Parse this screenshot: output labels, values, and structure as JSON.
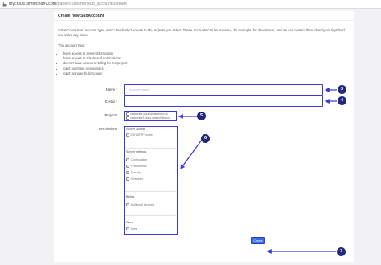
{
  "browser": {
    "url_host": "mycloud.simtechdev.com",
    "url_path": "/panel/customer/sub_accounts/create"
  },
  "form": {
    "title": "Create new SubAccount",
    "description": "SubAccount is an account type, which has limited access to the projects you select. These accounts can be provided, for example, for developers, and we can contact them directly via MyCloud and solve any issue.",
    "type_label": "This account type:",
    "type_bullets": [
      "have access to server information",
      "have access to tickets and notifications",
      "doesn't have access to billing for the project",
      "can't purchase new servers",
      "can't manage SubAccount"
    ],
    "name_label": "Name *",
    "name_placeholder": "Account name",
    "email_label": "E-Mail *",
    "projects_label": "Projects",
    "projects": [
      "testcentre.cloud.simtechdev.co",
      "testcentre2.cloud.simtechdev.co"
    ],
    "permissions_label": "Permissions",
    "permissions": {
      "server_access": {
        "title": "Server access",
        "items": [
          "SSH/SFTP Users"
        ]
      },
      "server_settings": {
        "title": "Server settings",
        "items": [
          "Configuration",
          "Performance",
          "Security",
          "Scheduler"
        ]
      },
      "billing": {
        "title": "Billing",
        "items": [
          "Additional services"
        ]
      },
      "sites": {
        "title": "Sites",
        "items": [
          "Sites"
        ]
      }
    },
    "create_button": "Create"
  },
  "callouts": [
    "3",
    "4",
    "5",
    "6",
    "7"
  ],
  "colors": {
    "highlight": "#3a38d8",
    "badge": "#24287a",
    "button": "#2f6fe0",
    "background": "#f2f2f4"
  }
}
